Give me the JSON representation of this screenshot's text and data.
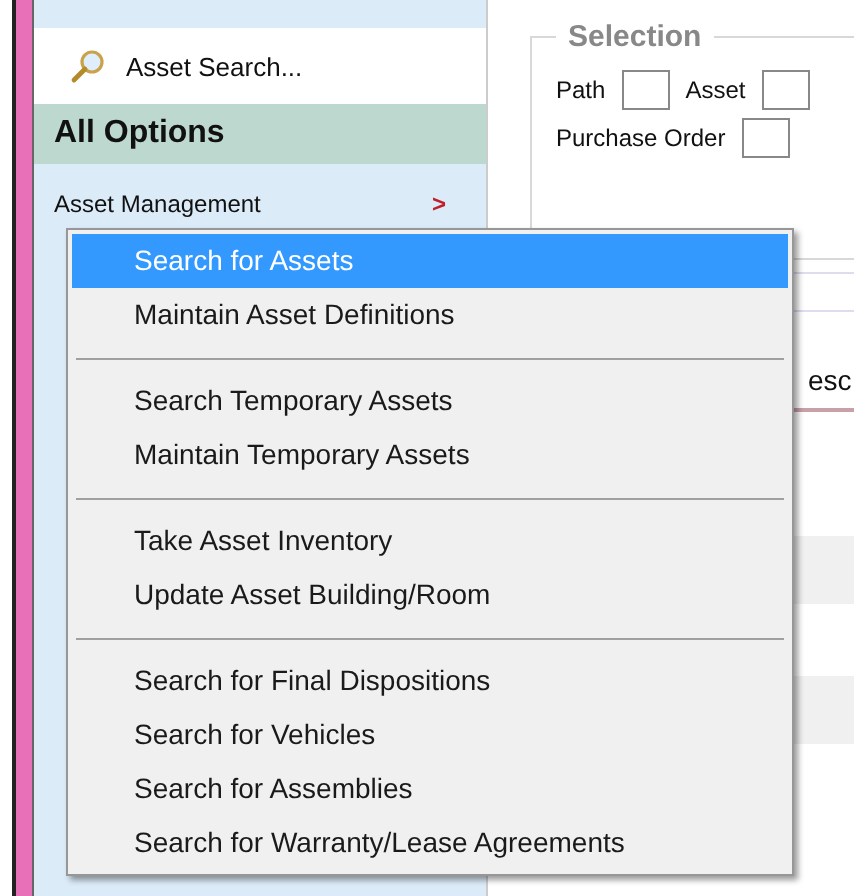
{
  "sidebar": {
    "search_link": "Asset Search...",
    "header": "All Options",
    "category": {
      "label": "Asset Management",
      "arrow": ">"
    }
  },
  "selection": {
    "title": "Selection",
    "fields": [
      {
        "label": "Path"
      },
      {
        "label": "Asset"
      },
      {
        "label": "Purchase Order"
      }
    ]
  },
  "table": {
    "column_header": "esc"
  },
  "menu": {
    "groups": [
      [
        {
          "label": "Search for Assets",
          "selected": true
        },
        {
          "label": "Maintain Asset Definitions",
          "selected": false
        }
      ],
      [
        {
          "label": "Search Temporary Assets",
          "selected": false
        },
        {
          "label": "Maintain Temporary Assets",
          "selected": false
        }
      ],
      [
        {
          "label": "Take Asset Inventory",
          "selected": false
        },
        {
          "label": "Update Asset Building/Room",
          "selected": false
        }
      ],
      [
        {
          "label": "Search for Final Dispositions",
          "selected": false
        },
        {
          "label": "Search for Vehicles",
          "selected": false
        },
        {
          "label": "Search for Assemblies",
          "selected": false
        },
        {
          "label": "Search for Warranty/Lease Agreements",
          "selected": false
        }
      ]
    ]
  }
}
